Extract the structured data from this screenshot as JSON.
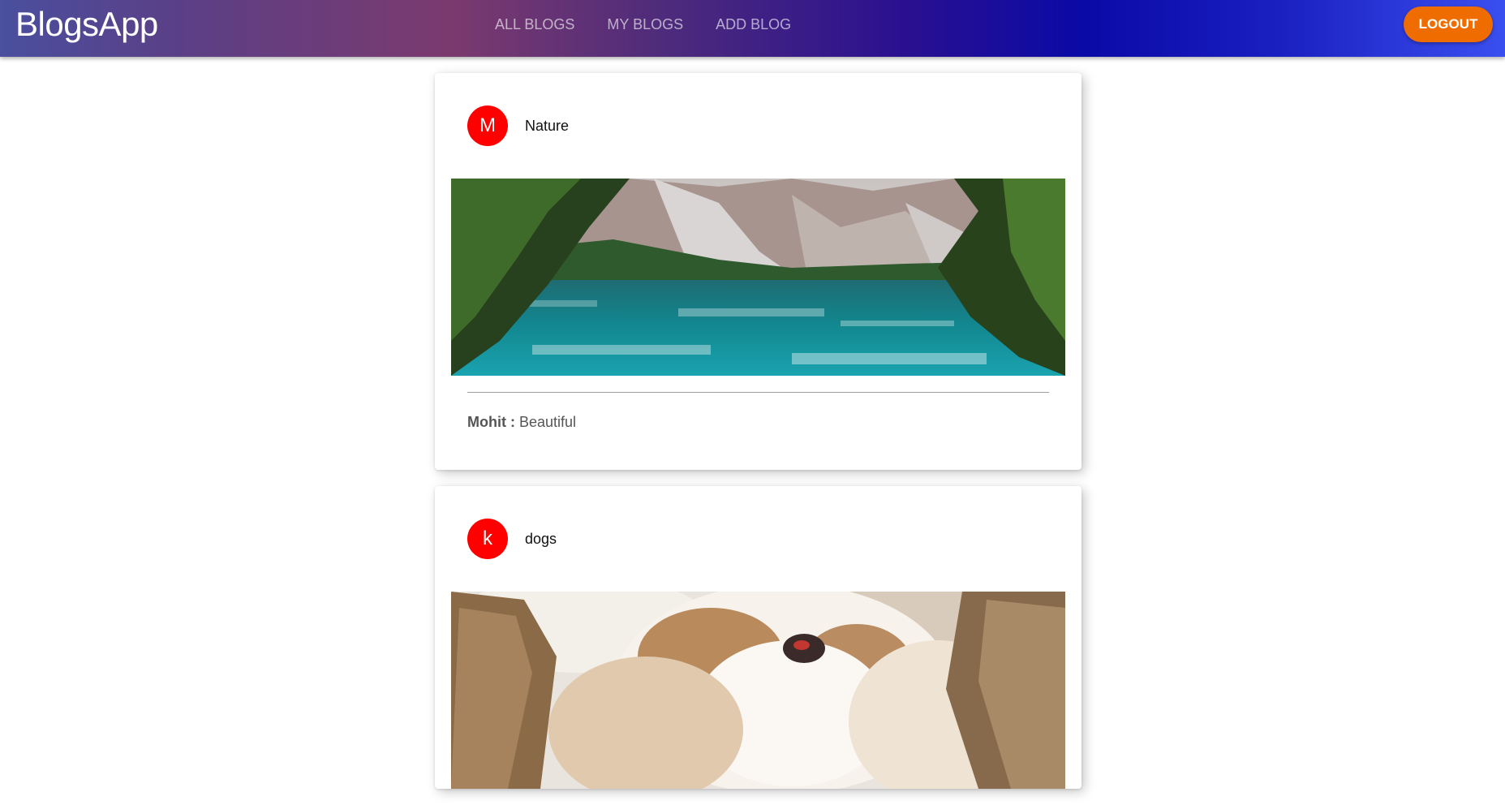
{
  "app": {
    "title": "BlogsApp",
    "accent_gradient": [
      "#4a4f9e",
      "#7b3a6e",
      "#0a0aa6",
      "#3a4ff0"
    ]
  },
  "nav": {
    "tabs": [
      {
        "label": "ALL BLOGS"
      },
      {
        "label": "MY BLOGS"
      },
      {
        "label": "ADD BLOG"
      }
    ]
  },
  "header": {
    "logout_label": "LOGOUT",
    "logout_color": "#ef6c00"
  },
  "blogs": [
    {
      "avatar_letter": "M",
      "avatar_color": "#ff0000",
      "title": "Nature",
      "image": "mountain-lake-photo",
      "comment": {
        "author": "Mohit",
        "separator": " : ",
        "text": "Beautiful"
      }
    },
    {
      "avatar_letter": "k",
      "avatar_color": "#ff0000",
      "title": "dogs",
      "image": "sleeping-puppies-photo"
    }
  ]
}
